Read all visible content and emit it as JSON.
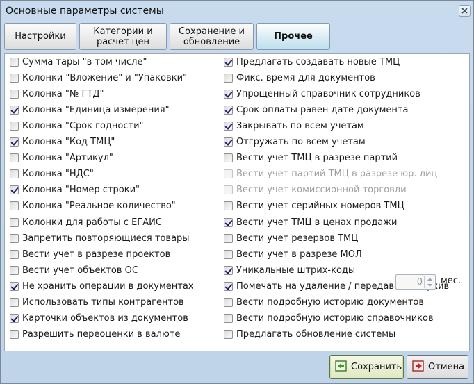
{
  "window": {
    "title": "Основные параметры системы"
  },
  "tabs": [
    {
      "label": "Настройки",
      "active": false
    },
    {
      "label": "Категории и\nрасчет цен",
      "active": false
    },
    {
      "label": "Сохранение и\nобновление",
      "active": false
    },
    {
      "label": "Прочее",
      "active": true
    }
  ],
  "left_options": [
    {
      "label": "Сумма тары \"в том числе\"",
      "checked": false
    },
    {
      "label": "Колонки \"Вложение\" и \"Упаковки\"",
      "checked": false
    },
    {
      "label": "Колонка \"№ ГТД\"",
      "checked": false
    },
    {
      "label": "Колонка \"Единица измерения\"",
      "checked": true
    },
    {
      "label": "Колонка \"Срок годности\"",
      "checked": false
    },
    {
      "label": "Колонка \"Код ТМЦ\"",
      "checked": true
    },
    {
      "label": "Колонка \"Артикул\"",
      "checked": false
    },
    {
      "label": "Колонка \"НДС\"",
      "checked": false
    },
    {
      "label": "Колонка \"Номер строки\"",
      "checked": true
    },
    {
      "label": "Колонка \"Реальное количество\"",
      "checked": false
    },
    {
      "label": "Колонки для работы с ЕГАИС",
      "checked": false
    },
    {
      "label": "Запретить повторяющиеся товары",
      "checked": false
    },
    {
      "label": "Вести учет в разрезе  проектов",
      "checked": false
    },
    {
      "label": "Вести учет объектов ОС",
      "checked": false
    },
    {
      "label": "Не хранить операции в документах",
      "checked": true
    },
    {
      "label": "Использовать типы контрагентов",
      "checked": false
    },
    {
      "label": "Карточки объектов из документов",
      "checked": true
    },
    {
      "label": "Разрешить переоценки в валюте",
      "checked": false
    }
  ],
  "right_options": [
    {
      "label": "Предлагать создавать новые ТМЦ",
      "checked": true,
      "disabled": false
    },
    {
      "label": "Фикс. время для документов",
      "checked": false,
      "disabled": false
    },
    {
      "label": "Упрощенный справочник сотрудников",
      "checked": true,
      "disabled": false
    },
    {
      "label": "Срок оплаты равен дате документа",
      "checked": true,
      "disabled": false
    },
    {
      "label": "Закрывать по всем учетам",
      "checked": true,
      "disabled": false
    },
    {
      "label": "Отгружать по всем учетам",
      "checked": true,
      "disabled": false
    },
    {
      "label": "Вести учет ТМЦ в разрезе партий",
      "checked": false,
      "disabled": false
    },
    {
      "label": "Вести учет партий ТМЦ в разрезе юр. лиц",
      "checked": false,
      "disabled": true
    },
    {
      "label": "Вести учет комиссионной торговли",
      "checked": false,
      "disabled": true
    },
    {
      "label": "Вести учет серийных номеров ТМЦ",
      "checked": false,
      "disabled": false
    },
    {
      "label": "Вести учет ТМЦ в ценах продажи",
      "checked": true,
      "disabled": false
    },
    {
      "label": "Вести учет резервов ТМЦ",
      "checked": false,
      "disabled": false
    },
    {
      "label": "Вести учет в разрезе МОЛ",
      "checked": false,
      "disabled": false
    },
    {
      "label": "Уникальные штрих-коды",
      "checked": true,
      "disabled": false
    },
    {
      "label": "Помечать на удаление / передавать в архив",
      "checked": true,
      "disabled": false
    },
    {
      "label": "Вести подробную историю документов",
      "checked": false,
      "disabled": false
    },
    {
      "label": "Вести подробную историю справочников",
      "checked": false,
      "disabled": false
    },
    {
      "label": "Предлагать обновление системы",
      "checked": false,
      "disabled": false
    }
  ],
  "update_months": {
    "value": "0",
    "unit": "мес."
  },
  "buttons": {
    "save": "Сохранить",
    "cancel": "Отмена"
  },
  "icons": {
    "close": "close-icon",
    "save": "save-icon",
    "cancel": "cancel-icon"
  }
}
